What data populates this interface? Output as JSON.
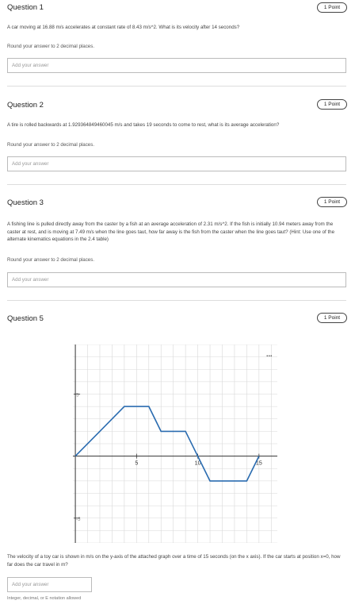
{
  "questions": [
    {
      "title": "Question 1",
      "points": "1 Point",
      "text": "A car moving at 16.88 m/s accelerates at constant rate of 8.43 m/s^2. What is its velocity after 14 seconds?",
      "hint": "Round your answer to 2 decimal places.",
      "placeholder": "Add your answer"
    },
    {
      "title": "Question 2",
      "points": "1 Point",
      "text": "A tire is rolled backwards at 1.929364849460045 m/s and takes 19 seconds to come to rest, what is its average acceleration?",
      "hint": "Round your answer to 2 decimal places.",
      "placeholder": "Add your answer"
    },
    {
      "title": "Question 3",
      "points": "1 Point",
      "text": "A fishing line is pulled directly away from the caster by a fish at an average acceleration of 2.31 m/s^2. If the fish is initially 10.94 meters away from the caster at rest, and is moving at 7.49 m/s when the line goes taut, how far away is the fish from the caster when the line goes taut? (Hint: Use one of the alternate kinematics equations in the 2.4 table)",
      "hint": "Round your answer to 2 decimal places.",
      "placeholder": "Add your answer"
    },
    {
      "title": "Question 5",
      "points": "1 Point",
      "text": "The velocity of a toy car is shown in m/s on the y-axis of the attached graph over a time of 15 seconds (on the x axis). If the car starts at position x=0, how far does the car travel in m?",
      "placeholder": "Add your answer",
      "note": "Integer, decimal, or E notation allowed",
      "graph_menu": "..."
    }
  ],
  "chart_data": {
    "type": "line",
    "x": [
      0,
      4,
      6,
      7,
      9,
      11,
      14,
      15
    ],
    "y": [
      0,
      4,
      4,
      2,
      2,
      -2,
      -2,
      0
    ],
    "xlim": [
      -0.2,
      16.5
    ],
    "ylim": [
      -7,
      9
    ],
    "x_tick_labels": [
      "5",
      "10",
      "15"
    ],
    "y_tick_labels": [
      "5",
      "-5"
    ],
    "grid": true,
    "line_color": "#2b6cb0"
  }
}
